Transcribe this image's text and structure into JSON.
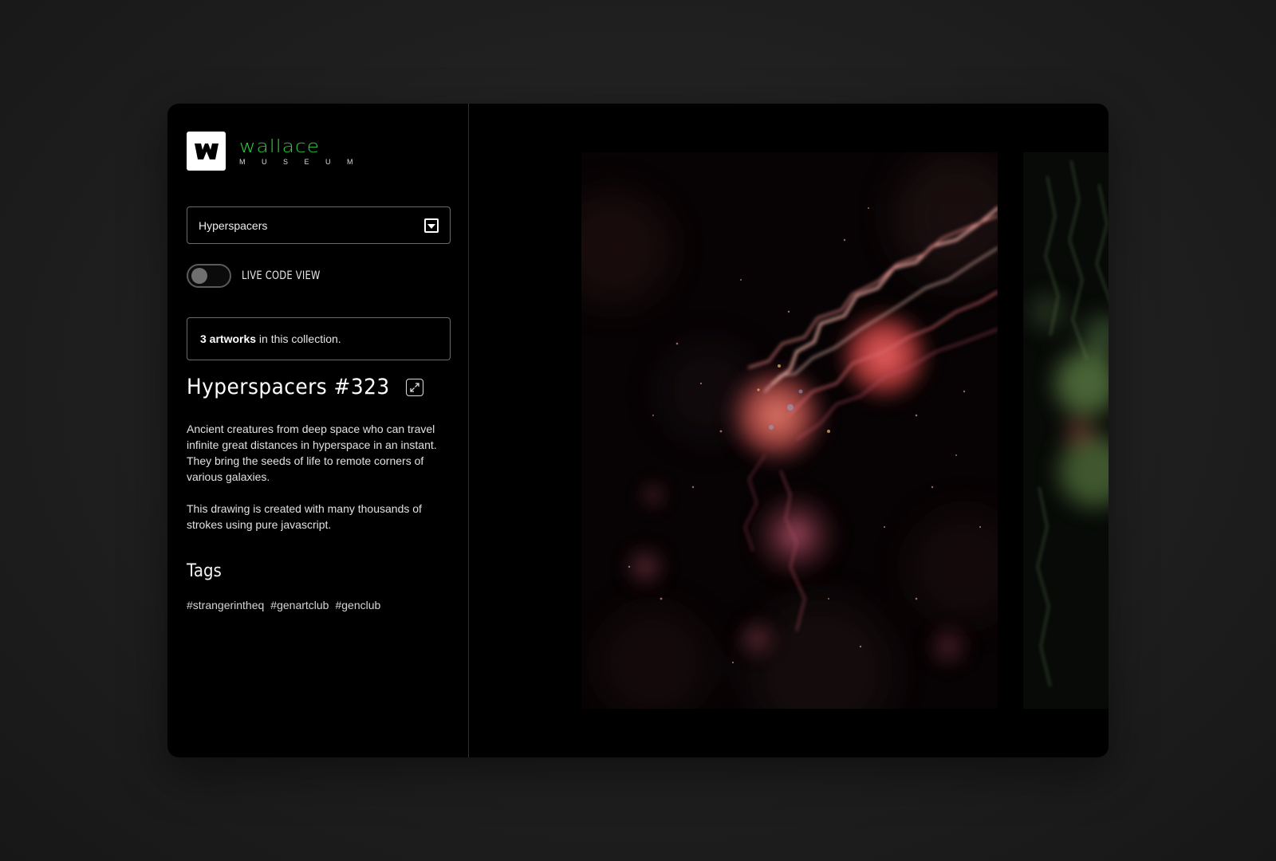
{
  "brand": {
    "logo_letter": "W",
    "wordmark": "wallace",
    "subtitle": "M U S E U M",
    "accent_color": "#2ecc40"
  },
  "collection_select": {
    "value": "Hyperspacers",
    "icon": "chevron-down-icon"
  },
  "live_code_toggle": {
    "label": "LIVE CODE VIEW",
    "state": "off"
  },
  "collection_count": {
    "count_text": "3 artworks",
    "suffix_text": " in this collection."
  },
  "artwork": {
    "title": "Hyperspacers #323",
    "expand_icon": "expand-icon",
    "description": [
      "Ancient creatures from deep space who can travel infinite great distances in hyperspace in an instant. They bring the seeds of life to remote corners of various galaxies.",
      "This drawing is created with many thousands of strokes using pure javascript."
    ]
  },
  "tags": {
    "heading": "Tags",
    "items": [
      "#strangerintheq",
      "#genartclub",
      "#genclub"
    ]
  }
}
